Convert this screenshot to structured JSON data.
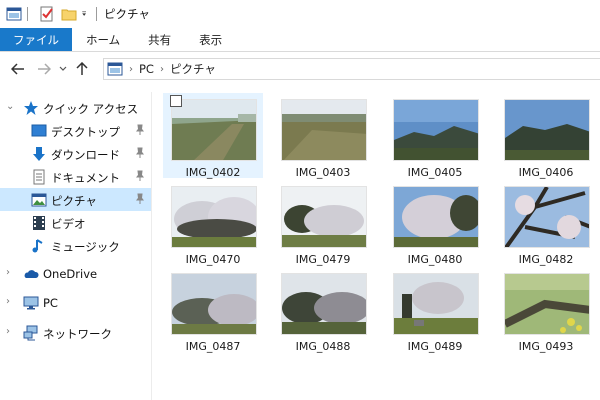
{
  "window": {
    "title": "ピクチャ"
  },
  "ribbon": {
    "tabs": [
      "ファイル",
      "ホーム",
      "共有",
      "表示"
    ]
  },
  "address": {
    "crumbs": [
      "PC",
      "ピクチャ"
    ]
  },
  "nav": {
    "quick_access": "クイック アクセス",
    "items": [
      "デスクトップ",
      "ダウンロード",
      "ドキュメント",
      "ピクチャ",
      "ビデオ",
      "ミュージック"
    ],
    "onedrive": "OneDrive",
    "pc": "PC",
    "network": "ネットワーク"
  },
  "files": [
    "IMG_0402",
    "IMG_0403",
    "IMG_0405",
    "IMG_0406",
    "IMG_0470",
    "IMG_0479",
    "IMG_0480",
    "IMG_0482",
    "IMG_0487",
    "IMG_0488",
    "IMG_0489",
    "IMG_0493"
  ],
  "colors": {
    "accent": "#1979ca",
    "selection": "#cce8ff"
  }
}
